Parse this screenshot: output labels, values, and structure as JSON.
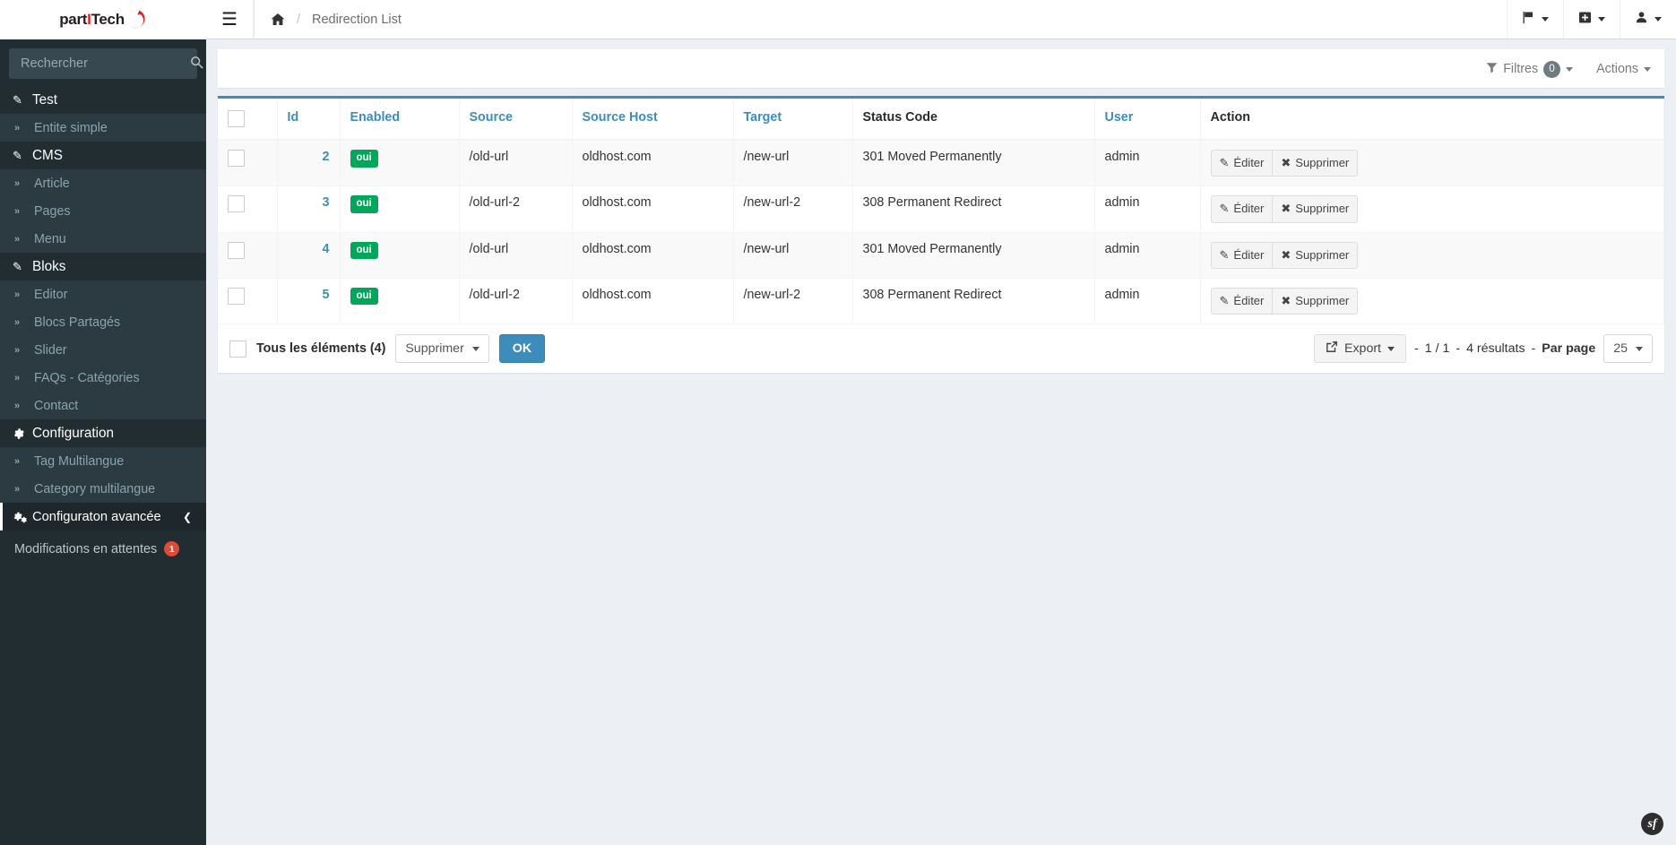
{
  "brand": {
    "name_part1": "part",
    "name_accent": "I",
    "name_part2": "Tech",
    "accent_color": "#e2211c"
  },
  "sidebar": {
    "search": {
      "placeholder": "Rechercher",
      "value": "",
      "icon": "search-icon"
    },
    "menu": [
      {
        "label": "Test",
        "icon": "pencil-icon",
        "type": "header"
      },
      {
        "label": "Entite simple",
        "icon": "chevron-double-right-icon",
        "type": "sub"
      },
      {
        "label": "CMS",
        "icon": "pencil-icon",
        "type": "header"
      },
      {
        "label": "Article",
        "icon": "chevron-double-right-icon",
        "type": "sub"
      },
      {
        "label": "Pages",
        "icon": "chevron-double-right-icon",
        "type": "sub"
      },
      {
        "label": "Menu",
        "icon": "chevron-double-right-icon",
        "type": "sub"
      },
      {
        "label": "Bloks",
        "icon": "pencil-icon",
        "type": "header"
      },
      {
        "label": "Editor",
        "icon": "chevron-double-right-icon",
        "type": "sub"
      },
      {
        "label": "Blocs Partagés",
        "icon": "chevron-double-right-icon",
        "type": "sub"
      },
      {
        "label": "Slider",
        "icon": "chevron-double-right-icon",
        "type": "sub"
      },
      {
        "label": "FAQs - Catégories",
        "icon": "chevron-double-right-icon",
        "type": "sub"
      },
      {
        "label": "Contact",
        "icon": "chevron-double-right-icon",
        "type": "sub"
      },
      {
        "label": "Configuration",
        "icon": "gear-icon",
        "type": "header"
      },
      {
        "label": "Tag Multilangue",
        "icon": "chevron-double-right-icon",
        "type": "sub"
      },
      {
        "label": "Category multilangue",
        "icon": "chevron-double-right-icon",
        "type": "sub"
      },
      {
        "label": "Configuraton avancée",
        "icon": "gears-icon",
        "type": "active",
        "trailing_icon": "chevron-left-icon"
      }
    ],
    "pending": {
      "label": "Modifications en attentes",
      "badge": "1",
      "badge_color": "#dd4b39"
    }
  },
  "topbar": {
    "menu_toggle_icon": "hamburger-icon",
    "breadcrumb": {
      "home_icon": "home-icon",
      "separator": "/",
      "current": "Redirection List"
    },
    "right_items": [
      {
        "icon": "flag-icon",
        "name": "language-dropdown"
      },
      {
        "icon": "plus-square-icon",
        "name": "add-dropdown"
      },
      {
        "icon": "user-icon",
        "name": "user-dropdown"
      }
    ]
  },
  "toolbar": {
    "filters_label": "Filtres",
    "filters_count": "0",
    "filters_icon": "funnel-icon",
    "actions_label": "Actions"
  },
  "table": {
    "columns": [
      {
        "label": "",
        "key": "checkbox",
        "sortable": false
      },
      {
        "label": "Id",
        "key": "id",
        "sortable": true
      },
      {
        "label": "Enabled",
        "key": "enabled",
        "sortable": true
      },
      {
        "label": "Source",
        "key": "source",
        "sortable": true
      },
      {
        "label": "Source Host",
        "key": "source_host",
        "sortable": true
      },
      {
        "label": "Target",
        "key": "target",
        "sortable": true
      },
      {
        "label": "Status Code",
        "key": "status_code",
        "sortable": false
      },
      {
        "label": "User",
        "key": "user",
        "sortable": true
      },
      {
        "label": "Action",
        "key": "action",
        "sortable": false
      }
    ],
    "rows": [
      {
        "id": "2",
        "enabled": "oui",
        "source": "/old-url",
        "source_host": "oldhost.com",
        "target": "/new-url",
        "status_code": "301 Moved Permanently",
        "user": "admin"
      },
      {
        "id": "3",
        "enabled": "oui",
        "source": "/old-url-2",
        "source_host": "oldhost.com",
        "target": "/new-url-2",
        "status_code": "308 Permanent Redirect",
        "user": "admin"
      },
      {
        "id": "4",
        "enabled": "oui",
        "source": "/old-url",
        "source_host": "oldhost.com",
        "target": "/new-url",
        "status_code": "301 Moved Permanently",
        "user": "admin"
      },
      {
        "id": "5",
        "enabled": "oui",
        "source": "/old-url-2",
        "source_host": "oldhost.com",
        "target": "/new-url-2",
        "status_code": "308 Permanent Redirect",
        "user": "admin"
      }
    ],
    "row_actions": {
      "edit_label": "Éditer",
      "edit_icon": "pencil-icon",
      "delete_label": "Supprimer",
      "delete_icon": "times-icon"
    },
    "enabled_badge_color": "#00a65a",
    "accent_color": "#3c8dbc"
  },
  "footer": {
    "select_all_label": "Tous les éléments (4)",
    "bulk_action": "Supprimer",
    "ok_label": "OK",
    "export_label": "Export",
    "export_icon": "external-share-icon",
    "pager_dash1": "-",
    "pager_range": "1 / 1",
    "pager_dash2": "-",
    "pager_results": "4 résultats",
    "pager_dash3": "-",
    "per_page_label": "Par page",
    "per_page_value": "25"
  },
  "debug": {
    "symfony_badge": "sf"
  }
}
